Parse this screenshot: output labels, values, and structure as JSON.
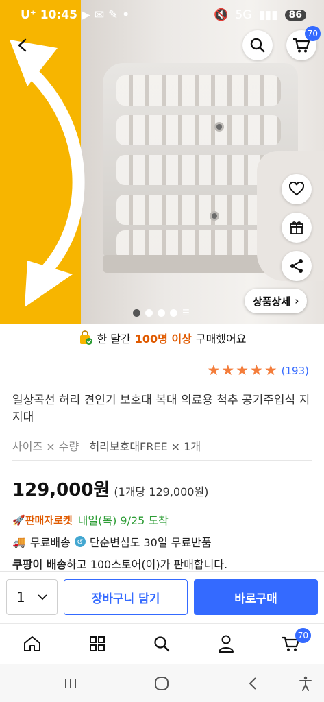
{
  "status_bar": {
    "carrier": "U⁺",
    "time": "10:45",
    "battery": "86"
  },
  "header": {
    "cart_count": "70"
  },
  "gallery": {
    "detail_button_label": "상품상세",
    "dot_count": 4
  },
  "banner": {
    "prefix": "한 달간",
    "highlight": "100명 이상",
    "suffix": "구매했어요"
  },
  "rating": {
    "stars": 5,
    "review_count": "(193)"
  },
  "product": {
    "title": "일상곡선 허리 견인기 보호대 복대 의료용 척추 공기주입식 지지대",
    "option_label": "사이즈 × 수량",
    "option_value": "허리보호대FREE × 1개",
    "price": "129,000원",
    "unit_price": "(1개당 129,000원)"
  },
  "delivery": {
    "badge": "판매자로켓",
    "eta": "내일(목) 9/25 도착",
    "free_shipping": "무료배송",
    "free_return": "단순변심도 30일 무료반품",
    "seller_prefix": "쿠팡이 배송",
    "seller_suffix": "하고 100스토어(이)가 판매합니다."
  },
  "buy_bar": {
    "quantity": "1",
    "cart_button": "장바구니 담기",
    "buy_button": "바로구매"
  },
  "tab_bar": {
    "cart_badge": "70"
  },
  "colors": {
    "accent": "#346aff",
    "rocket": "#e05a00",
    "eta": "#2e9d36",
    "star": "#f47d3b"
  }
}
